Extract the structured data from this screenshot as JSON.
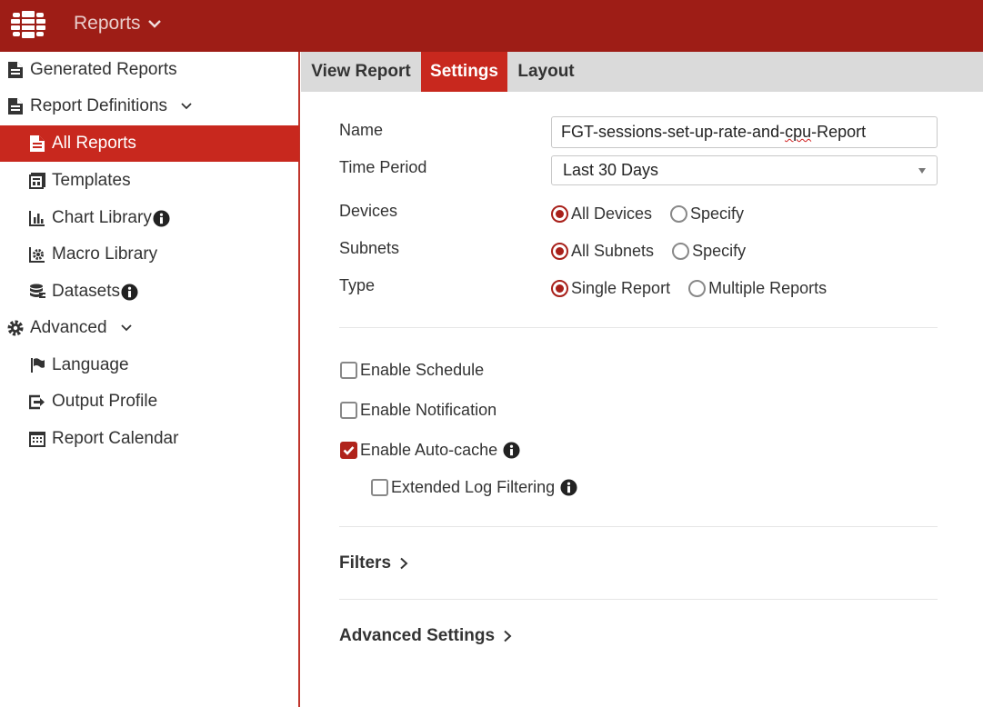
{
  "header": {
    "app_title": "Reports"
  },
  "sidebar": {
    "items": [
      {
        "label": "Generated Reports",
        "icon": "document-icon"
      },
      {
        "label": "Report Definitions",
        "icon": "document-icon"
      },
      {
        "label": "All Reports",
        "icon": "document-icon"
      },
      {
        "label": "Templates",
        "icon": "template-icon"
      },
      {
        "label": "Chart Library",
        "icon": "bar-chart-icon"
      },
      {
        "label": "Macro Library",
        "icon": "macro-gear-icon"
      },
      {
        "label": "Datasets",
        "icon": "database-icon"
      },
      {
        "label": "Advanced",
        "icon": "gear-icon"
      },
      {
        "label": "Language",
        "icon": "flag-icon"
      },
      {
        "label": "Output Profile",
        "icon": "output-icon"
      },
      {
        "label": "Report Calendar",
        "icon": "calendar-icon"
      }
    ]
  },
  "tabs": [
    {
      "label": "View Report"
    },
    {
      "label": "Settings"
    },
    {
      "label": "Layout"
    }
  ],
  "form": {
    "name_label": "Name",
    "name_value_prefix": "FGT-sessions-set-up-rate-and-",
    "name_value_misspelled": "cpu",
    "name_value_suffix": "-Report",
    "time_period_label": "Time Period",
    "time_period_value": "Last 30 Days",
    "devices_label": "Devices",
    "devices_opt1": "All Devices",
    "devices_opt2": "Specify",
    "subnets_label": "Subnets",
    "subnets_opt1": "All Subnets",
    "subnets_opt2": "Specify",
    "type_label": "Type",
    "type_opt1": "Single Report",
    "type_opt2": "Multiple Reports",
    "enable_schedule": "Enable Schedule",
    "enable_notification": "Enable Notification",
    "enable_autocache": "Enable Auto-cache",
    "extended_log_filtering": "Extended Log Filtering",
    "filters_label": "Filters",
    "advanced_settings_label": "Advanced Settings"
  },
  "colors": {
    "brand": "#9e1d16",
    "accent": "#c8281e"
  }
}
